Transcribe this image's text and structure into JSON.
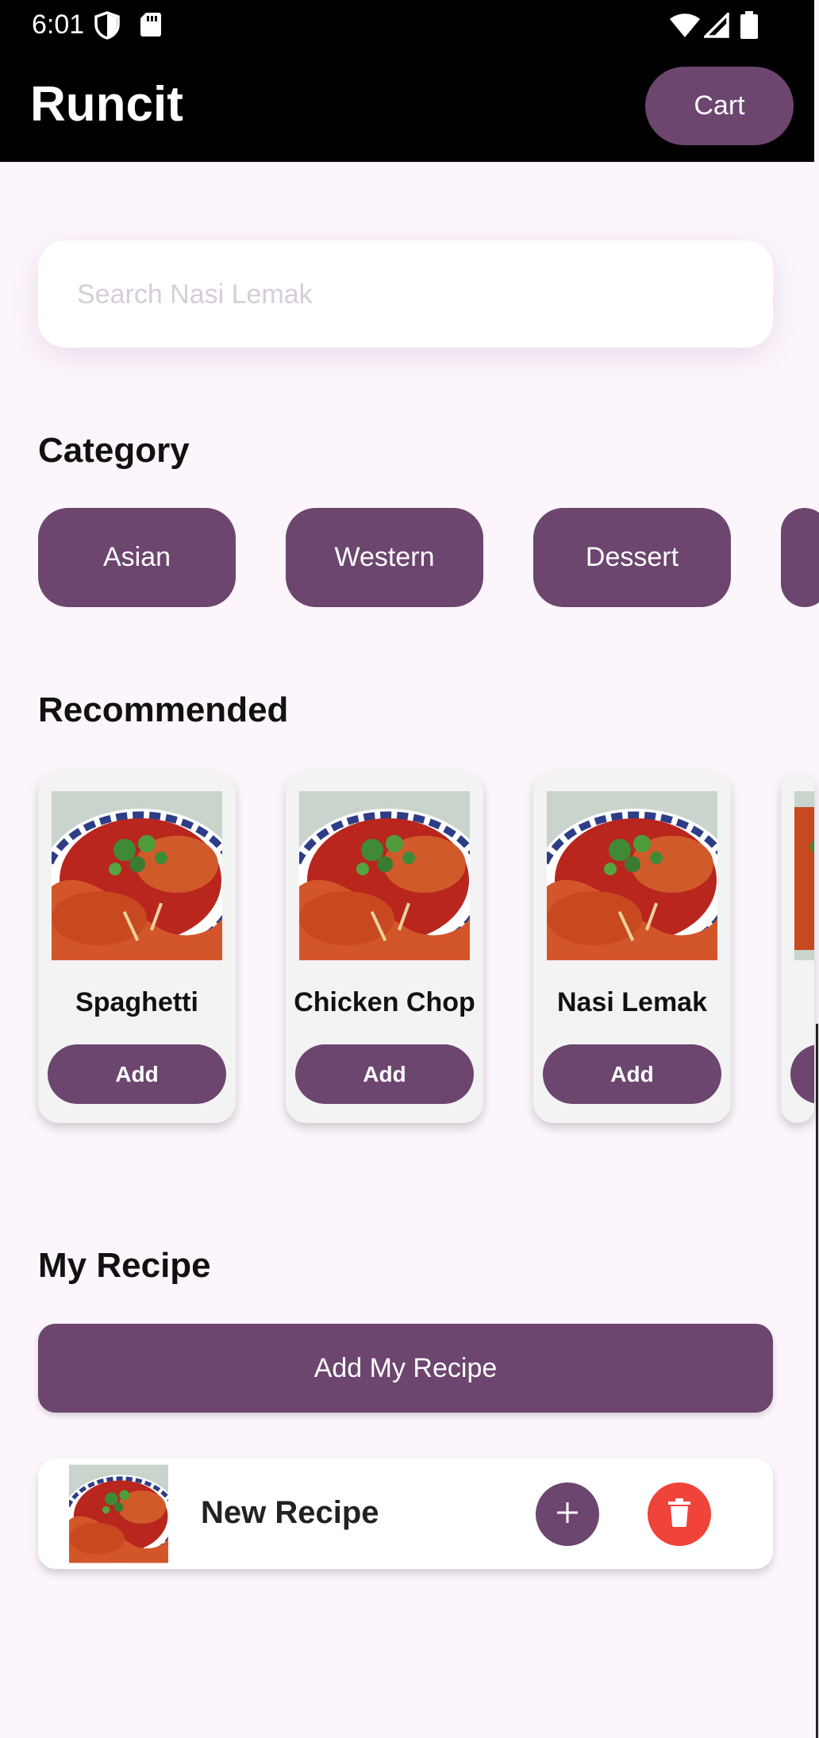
{
  "status_bar": {
    "time": "6:01",
    "icons": [
      "shield-icon",
      "sd-card-icon",
      "wifi-icon",
      "signal-icon",
      "battery-icon"
    ]
  },
  "app_bar": {
    "title": "Runcit",
    "cart_label": "Cart"
  },
  "search": {
    "placeholder": "Search Nasi Lemak",
    "value": ""
  },
  "category": {
    "title": "Category",
    "items": [
      "Asian",
      "Western",
      "Dessert",
      ""
    ]
  },
  "recommended": {
    "title": "Recommended",
    "items": [
      {
        "name": "Spaghetti",
        "button": "Add"
      },
      {
        "name": "Chicken Chop",
        "button": "Add"
      },
      {
        "name": "Nasi Lemak",
        "button": "Add"
      }
    ]
  },
  "my_recipe": {
    "title": "My Recipe",
    "add_button": "Add My Recipe",
    "items": [
      {
        "name": "New Recipe"
      }
    ]
  },
  "colors": {
    "primary": "#6c466f",
    "background": "#fcf5fc",
    "delete": "#f0433a",
    "app_bar": "#000000"
  }
}
